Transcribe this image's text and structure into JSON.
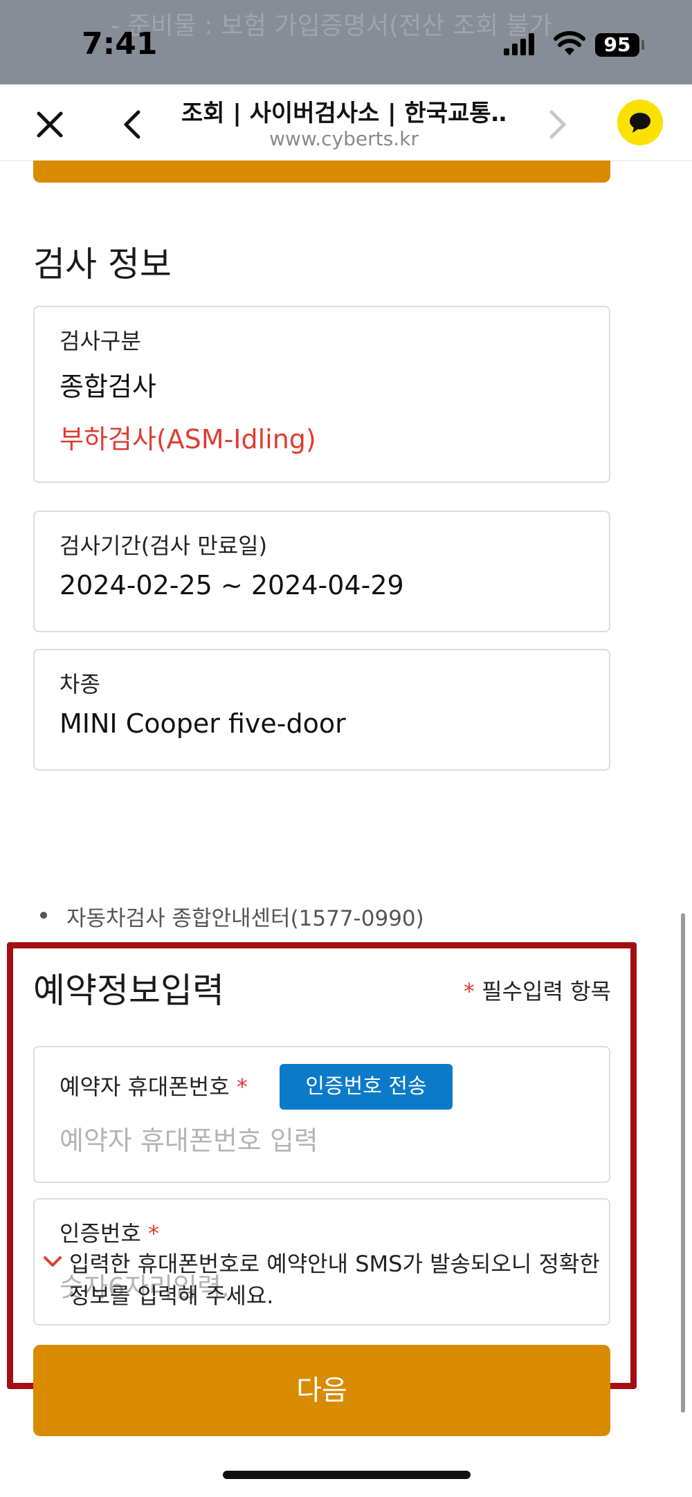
{
  "status_bar": {
    "time": "7:41",
    "battery": "95",
    "behind_text": "- 준비물 : 보험 가입증명서(전산 조회 불가"
  },
  "browser": {
    "title": "조회 | 사이버검사소 | 한국교통…",
    "domain": "www.cyberts.kr"
  },
  "inspection_info": {
    "section_title": "검사 정보",
    "type_label": "검사구분",
    "type_value": "종합검사",
    "type_sub": "부하검사(ASM-Idling)",
    "period_label": "검사기간(검사 만료일)",
    "period_value": "2024-02-25 ~ 2024-04-29",
    "car_label": "차종",
    "car_value": "MINI Cooper five-door",
    "contact": "자동차검사 종합안내센터(1577-0990)"
  },
  "reservation": {
    "title": "예약정보입력",
    "required_star": "*",
    "required_note": "필수입력 항목",
    "phone_label": "예약자 휴대폰번호",
    "phone_placeholder": "예약자 휴대폰번호 입력",
    "send_code_label": "인증번호 전송",
    "code_label": "인증번호",
    "code_placeholder": "숫자6자리입력.",
    "notice": "입력한 휴대폰번호로 예약안내 SMS가 발송되오니 정확한 정보를 입력해 주세요."
  },
  "next_button": "다음",
  "colors": {
    "accent_orange": "#d98b00",
    "blue_button": "#0b7ac9",
    "highlight_frame": "#a30f14",
    "required_red": "#e03c31"
  }
}
